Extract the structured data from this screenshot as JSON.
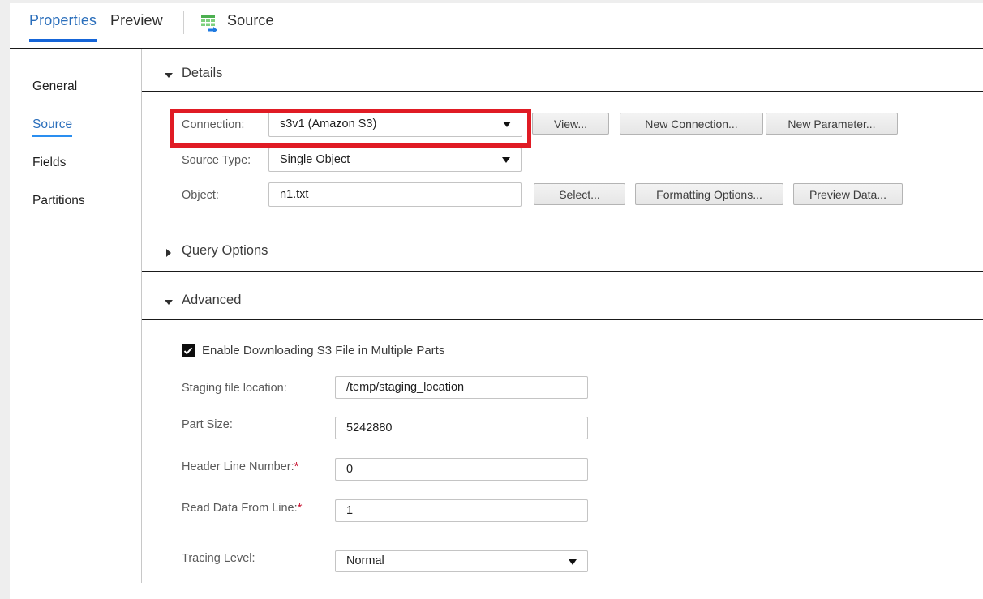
{
  "tabs": [
    {
      "label": "Properties",
      "active": true,
      "icon": null
    },
    {
      "label": "Preview",
      "active": false,
      "icon": null
    },
    {
      "label": "Source",
      "active": false,
      "icon": "source-table-arrow-icon"
    }
  ],
  "sidebar": {
    "items": [
      {
        "label": "General",
        "active": false
      },
      {
        "label": "Source",
        "active": true
      },
      {
        "label": "Fields",
        "active": false
      },
      {
        "label": "Partitions",
        "active": false
      }
    ]
  },
  "sections": {
    "details": {
      "label": "Details",
      "expanded": true
    },
    "query_options": {
      "label": "Query Options",
      "expanded": false
    },
    "advanced": {
      "label": "Advanced",
      "expanded": true
    }
  },
  "details": {
    "connection": {
      "label": "Connection:",
      "value": "s3v1 (Amazon S3)",
      "buttons": [
        "View...",
        "New Connection...",
        "New Parameter..."
      ]
    },
    "source_type": {
      "label": "Source Type:",
      "value": "Single Object"
    },
    "object": {
      "label": "Object:",
      "value": "n1.txt",
      "buttons": [
        "Select...",
        "Formatting Options...",
        "Preview Data..."
      ]
    }
  },
  "advanced": {
    "enable_multipart": {
      "label": "Enable Downloading S3 File in Multiple Parts",
      "checked": true
    },
    "staging_file_location": {
      "label": "Staging file location:",
      "value": "/temp/staging_location",
      "required": false
    },
    "part_size": {
      "label": "Part Size:",
      "value": "5242880",
      "required": false
    },
    "header_line_number": {
      "label": "Header Line Number:",
      "value": "0",
      "required": true,
      "required_mark": "*"
    },
    "read_data_from_line": {
      "label": "Read Data From Line:",
      "value": "1",
      "required": true,
      "required_mark": "*"
    },
    "tracing_level": {
      "label": "Tracing Level:",
      "value": "Normal"
    }
  },
  "highlight": {
    "target": "connection-row",
    "color": "#e01b24"
  },
  "colors": {
    "accent_blue": "#2a6ebb",
    "tab_underline": "#1565d8",
    "sidebar_underline": "#2a8ef0",
    "required_red": "#c8102e",
    "highlight_red": "#e01b24"
  }
}
